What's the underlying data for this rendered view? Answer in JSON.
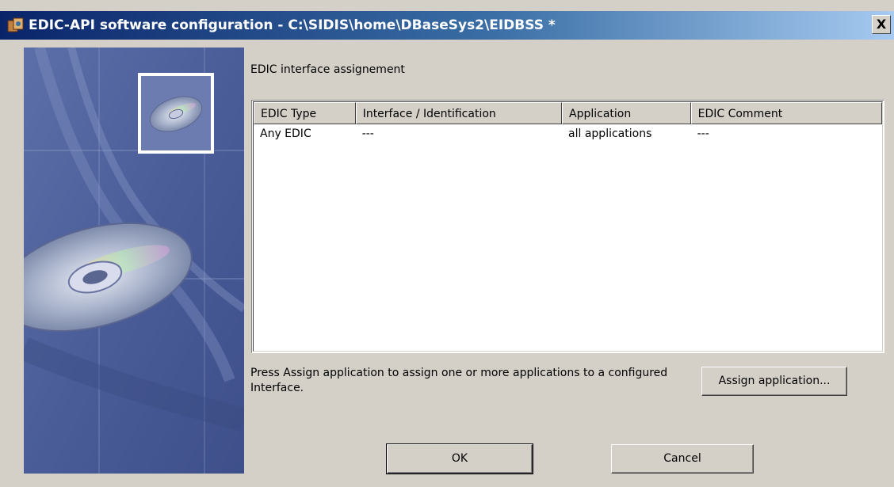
{
  "window": {
    "title": "EDIC-API software configuration - C:\\SIDIS\\home\\DBaseSys2\\EIDBSS *",
    "close_label": "X"
  },
  "main": {
    "group_label": "EDIC interface assignement",
    "columns": [
      "EDIC Type",
      "Interface / Identification",
      "Application",
      "EDIC Comment"
    ],
    "rows": [
      [
        "Any EDIC",
        "---",
        "all applications",
        "---"
      ]
    ],
    "hint": "Press Assign application to assign one or more applications to a configured Interface.",
    "assign_button": "Assign application...",
    "ok_button": "OK",
    "cancel_button": "Cancel"
  },
  "colors": {
    "title_gradient_start": "#0a246a",
    "dialog_bg": "#d4d0c8"
  },
  "icons": {
    "title_icon": "app-config-icon",
    "side_image": "cd-rom-illustration"
  }
}
